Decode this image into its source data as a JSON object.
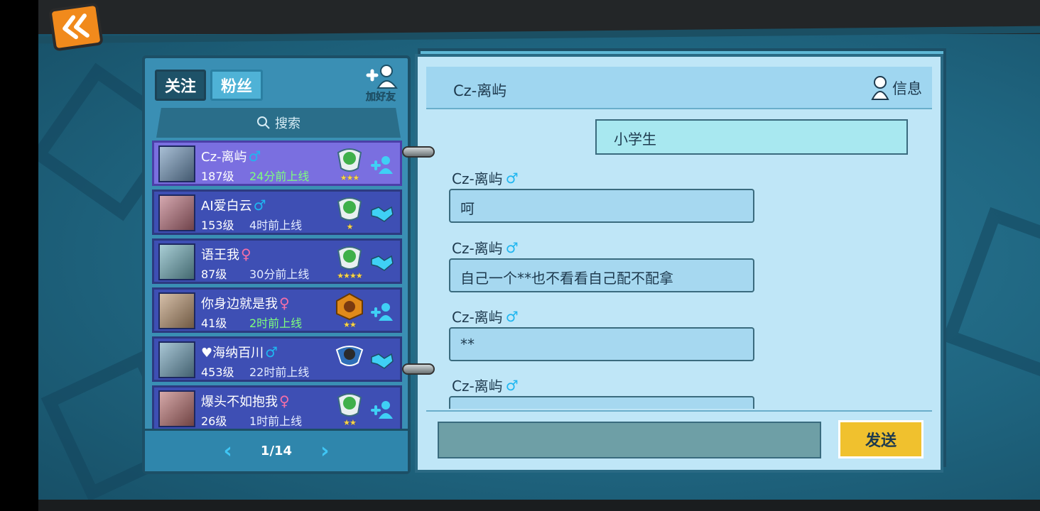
{
  "tabs": {
    "follow": "关注",
    "fans": "粉丝"
  },
  "add_friend_label": "加好友",
  "search_label": "搜索",
  "friends": [
    {
      "name": "Cz-离屿",
      "gender": "♂",
      "gender_type": "male",
      "level": "187级",
      "online": "24分前上线",
      "online_color": "green",
      "stars": "★★★",
      "action": "add",
      "selected": true
    },
    {
      "name": "AI爱白云",
      "gender": "♂",
      "gender_type": "male",
      "level": "153级",
      "online": "4时前上线",
      "online_color": "white",
      "stars": "★",
      "action": "mutual",
      "selected": false
    },
    {
      "name": "语王我",
      "gender": "♀",
      "gender_type": "female",
      "level": "87级",
      "online": "30分前上线",
      "online_color": "white",
      "stars": "★★★★",
      "action": "mutual",
      "selected": false
    },
    {
      "name": "你身边就是我",
      "gender": "♀",
      "gender_type": "female",
      "level": "41级",
      "online": "2时前上线",
      "online_color": "green",
      "stars": "★★",
      "action": "add",
      "selected": false
    },
    {
      "name": "♥海纳百川",
      "gender": "♂",
      "gender_type": "male",
      "level": "453级",
      "online": "22时前上线",
      "online_color": "white",
      "stars": "",
      "action": "mutual",
      "selected": false
    },
    {
      "name": "爆头不如抱我",
      "gender": "♀",
      "gender_type": "female",
      "level": "26级",
      "online": "1时前上线",
      "online_color": "white",
      "stars": "★★",
      "action": "add",
      "selected": false
    }
  ],
  "pager": {
    "prev": "‹",
    "next": "›",
    "page": "1/14"
  },
  "chat": {
    "title": "Cz-离屿",
    "info_label": "信息",
    "self_message": "小学生",
    "messages": [
      {
        "sender": "Cz-离屿",
        "gender": "♂",
        "text": "呵"
      },
      {
        "sender": "Cz-离屿",
        "gender": "♂",
        "text": "自己一个**也不看看自己配不配拿"
      },
      {
        "sender": "Cz-离屿",
        "gender": "♂",
        "text": "**"
      },
      {
        "sender": "Cz-离屿",
        "gender": "♂",
        "text": ""
      }
    ],
    "send_label": "发送"
  },
  "colors": {
    "accent": "#f0c12e",
    "row": "#3e4fb4",
    "row_selected": "#7a6fe0",
    "male": "#1fb6f0",
    "female": "#f46fa8"
  }
}
